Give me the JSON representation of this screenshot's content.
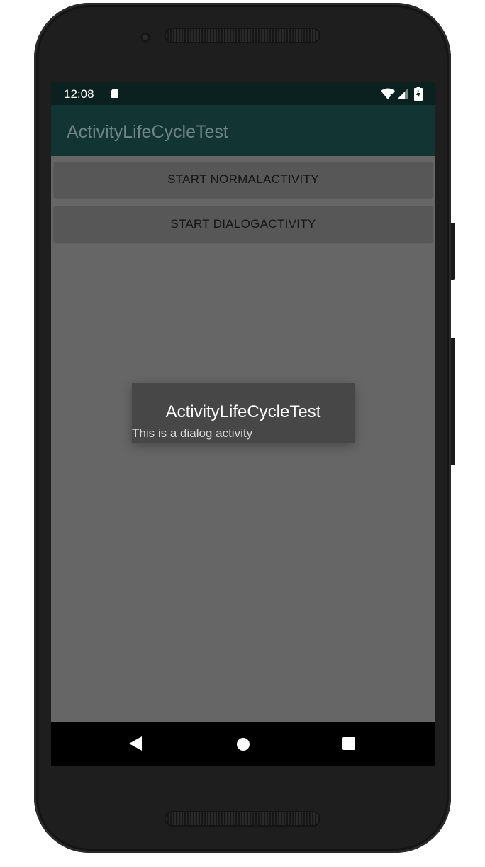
{
  "status_bar": {
    "time": "12:08",
    "icons": [
      "sd-card-icon",
      "wifi-icon",
      "signal-icon",
      "battery-charging-icon"
    ]
  },
  "app_bar": {
    "title": "ActivityLifeCycleTest",
    "background_color": "#123534"
  },
  "buttons": {
    "normal_activity": "START NORMALACTIVITY",
    "dialog_activity": "START DIALOGACTIVITY"
  },
  "dialog": {
    "title": "ActivityLifeCycleTest",
    "message": "This is a dialog activity"
  },
  "nav_bar": {
    "icons": [
      "back-icon",
      "home-icon",
      "recents-icon"
    ]
  }
}
